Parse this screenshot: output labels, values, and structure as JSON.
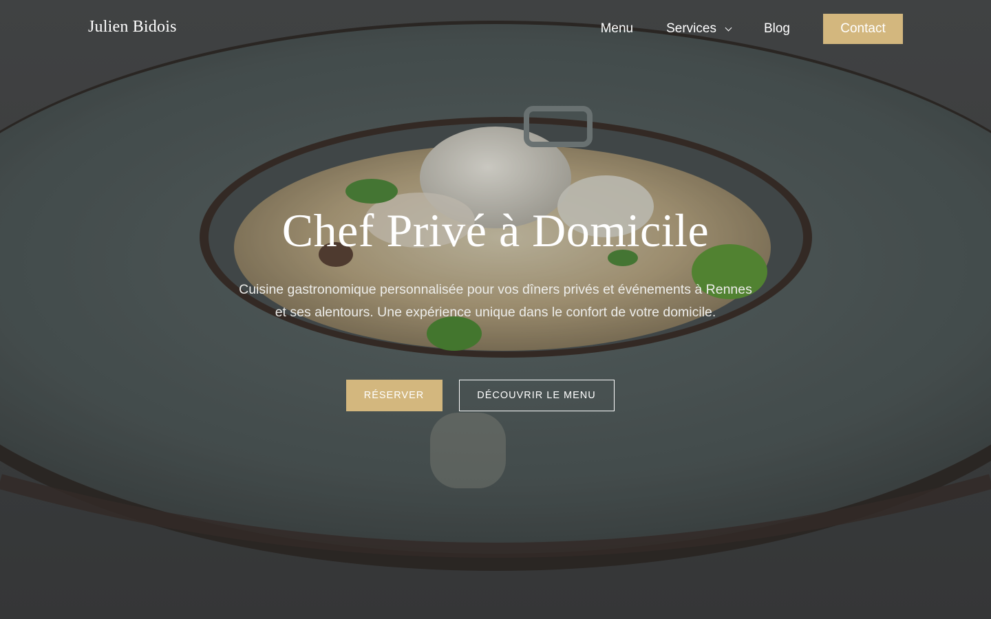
{
  "brand": {
    "name": "Julien Bidois"
  },
  "nav": {
    "items": [
      {
        "label": "Menu"
      },
      {
        "label": "Services",
        "has_dropdown": true
      },
      {
        "label": "Blog"
      }
    ],
    "cta_label": "Contact"
  },
  "hero": {
    "title": "Chef Privé à Domicile",
    "subtitle": "Cuisine gastronomique personnalisée pour vos dîners privés et événements à Rennes et ses alentours. Une expérience unique dans le confort de votre domicile.",
    "primary_cta": "RÉSERVER",
    "secondary_cta": "DÉCOUVRIR LE MENU"
  },
  "colors": {
    "accent": "#d3b77e",
    "overlay": "#2a2d2f",
    "text": "#ffffff"
  }
}
